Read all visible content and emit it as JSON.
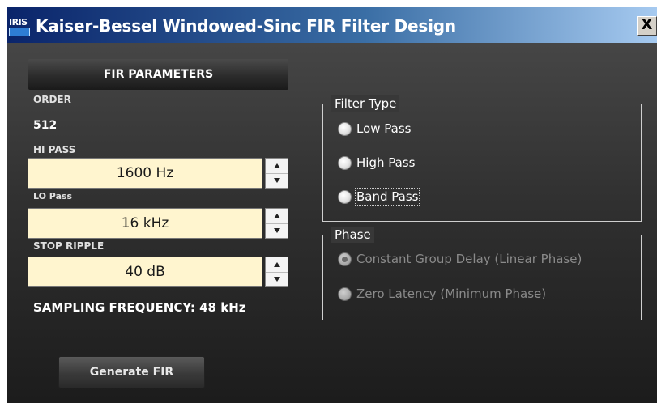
{
  "window": {
    "title": "Kaiser-Bessel Windowed-Sinc FIR Filter Design",
    "logo_text": "IRIS",
    "close_label": "X"
  },
  "fir_parameters": {
    "header": "FIR PARAMETERS",
    "order_label": "ORDER",
    "order_value": "512",
    "hi_pass_label": "HI PASS",
    "hi_pass_value": "1600 Hz",
    "lo_pass_label": "LO Pass",
    "lo_pass_value": "16 kHz",
    "stop_ripple_label": "STOP RIPPLE",
    "stop_ripple_value": "40 dB",
    "sampling_frequency": "SAMPLING FREQUENCY: 48 kHz"
  },
  "filter_type": {
    "title": "Filter Type",
    "options": [
      "Low Pass",
      "High Pass",
      "Band Pass"
    ],
    "selected": null,
    "focused": "Band Pass"
  },
  "phase": {
    "title": "Phase",
    "options": [
      "Constant Group Delay (Linear Phase)",
      "Zero Latency (Minimum Phase)"
    ],
    "selected": "Constant Group Delay (Linear Phase)",
    "enabled": false
  },
  "actions": {
    "generate_label": "Generate FIR"
  },
  "colors": {
    "titlebar_start": "#0a246a",
    "titlebar_end": "#a6caf0",
    "panel_bg": "#303030",
    "input_bg": "#fff5cf"
  }
}
